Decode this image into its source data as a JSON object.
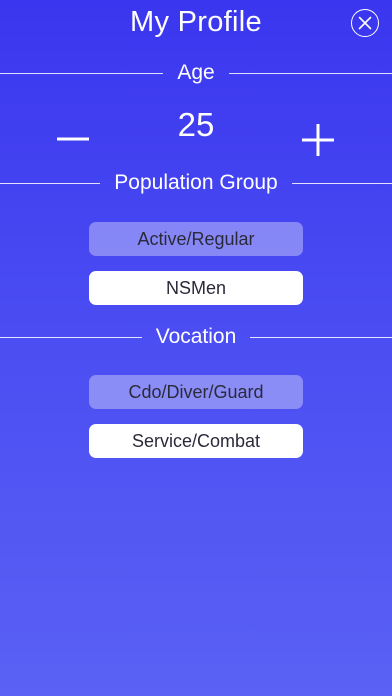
{
  "header": {
    "title": "My Profile",
    "close_icon": "close-circle-icon"
  },
  "age": {
    "label": "Age",
    "value": "25",
    "decrement_icon": "minus-icon",
    "increment_icon": "plus-icon"
  },
  "population_group": {
    "label": "Population Group",
    "options": [
      {
        "label": "Active/Regular",
        "selected": true
      },
      {
        "label": "NSMen",
        "selected": false
      }
    ]
  },
  "vocation": {
    "label": "Vocation",
    "options": [
      {
        "label": "Cdo/Diver/Guard",
        "selected": true
      },
      {
        "label": "Service/Combat",
        "selected": false
      }
    ]
  },
  "colors": {
    "background_top": "#3a36ef",
    "background_bottom": "#5a61f4",
    "text": "#ffffff",
    "option_text": "#2a2a3a"
  }
}
